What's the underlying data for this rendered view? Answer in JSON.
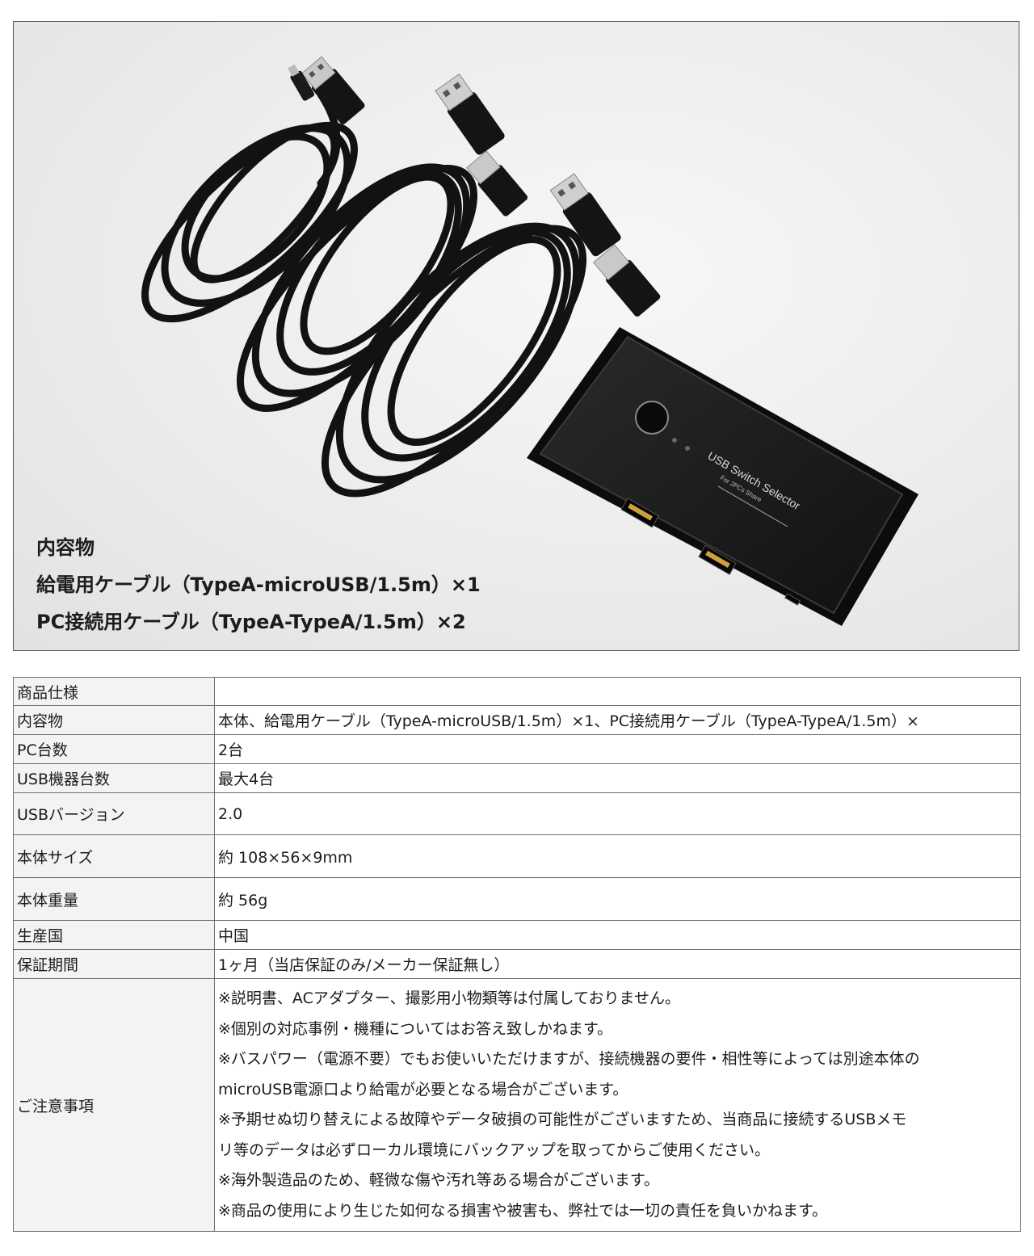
{
  "photo": {
    "device_label": "USB Switch Selector",
    "device_sublabel": "For 2PCs Share",
    "contents_title": "内容物",
    "contents_lines": [
      "給電用ケーブル（TypeA-microUSB/1.5m）×1",
      "PC接続用ケーブル（TypeA-TypeA/1.5m）×2"
    ]
  },
  "spec": {
    "rows": [
      {
        "label": "商品仕様",
        "value": ""
      },
      {
        "label": "内容物",
        "value": "本体、給電用ケーブル（TypeA-microUSB/1.5m）×1、PC接続用ケーブル（TypeA-TypeA/1.5m）×"
      },
      {
        "label": "PC台数",
        "value": "2台"
      },
      {
        "label": "USB機器台数",
        "value": "最大4台"
      },
      {
        "label": "USBバージョン",
        "value": "2.0"
      },
      {
        "label": "本体サイズ",
        "value": "約 108×56×9mm"
      },
      {
        "label": "本体重量",
        "value": "約 56g"
      },
      {
        "label": "生産国",
        "value": "中国"
      },
      {
        "label": "保証期間",
        "value": "1ヶ月（当店保証のみ/メーカー保証無し）"
      }
    ],
    "notes_label": "ご注意事項",
    "notes": [
      "※説明書、ACアダプター、撮影用小物類等は付属しておりません。",
      "※個別の対応事例・機種についてはお答え致しかねます。",
      "※バスパワー（電源不要）でもお使いいただけますが、接続機器の要件・相性等によっては別途本体の",
      "microUSB電源口より給電が必要となる場合がございます。",
      "※予期せぬ切り替えによる故障やデータ破損の可能性がございますため、当商品に接続するUSBメモ",
      "リ等のデータは必ずローカル環境にバックアップを取ってからご使用ください。",
      "※海外製造品のため、軽微な傷や汚れ等ある場合がございます。",
      "※商品の使用により生じた如何なる損害や被害も、弊社では一切の責任を負いかねます。"
    ]
  }
}
